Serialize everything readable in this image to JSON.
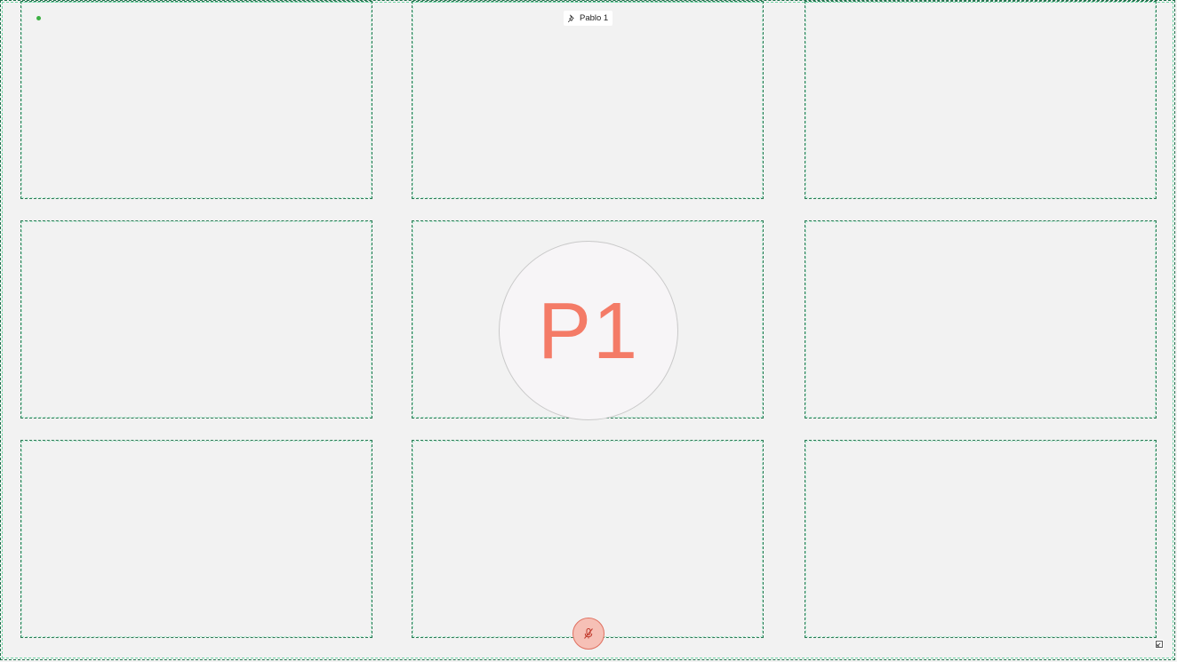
{
  "participant": {
    "name": "Pablo 1",
    "initials": "P1",
    "pinned": true,
    "mic_muted": true
  },
  "icons": {
    "pin": "pin-icon",
    "mic": "mic-off-icon",
    "expand": "expand-icon",
    "status": "status-dot"
  },
  "colors": {
    "background": "#f2f2f2",
    "tile_outline": "#2b7a55",
    "tile_outline_light": "#7ee3b5",
    "initials": "#f47b67",
    "status_dot": "#3cb043",
    "mute_fill": "#f6c0b6",
    "mute_stroke": "#e07060"
  }
}
